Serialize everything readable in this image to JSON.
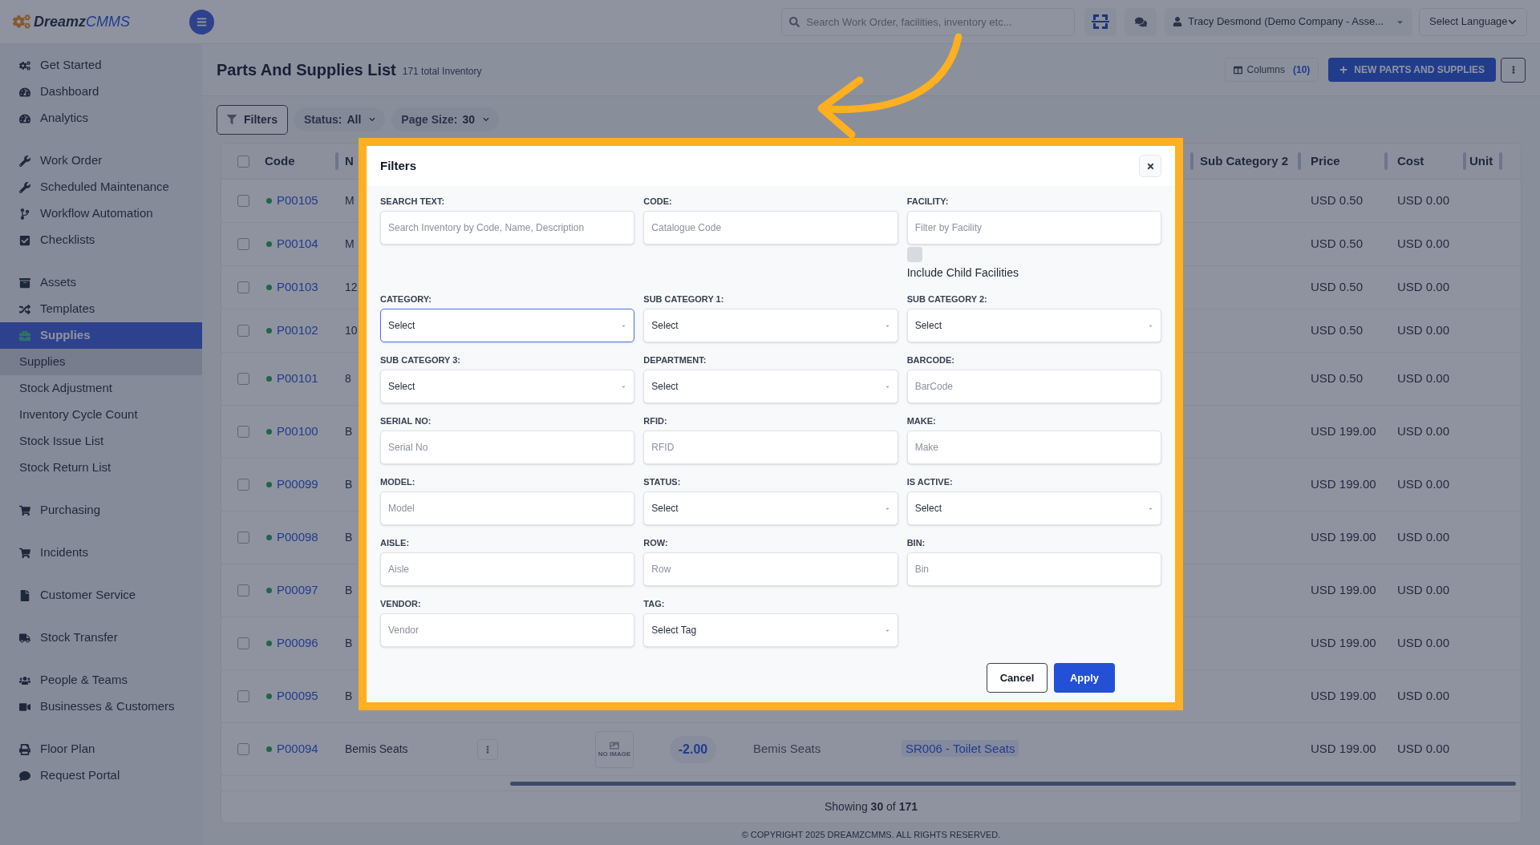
{
  "topbar": {
    "logo": {
      "word": "Dreamz",
      "accent": "CMMS"
    },
    "search": {
      "placeholder": "Search Work Order, facilities, inventory etc..."
    },
    "user": "Tracy Desmond (Demo Company - Asse...",
    "language": "Select Language"
  },
  "sidebar": {
    "groups": [
      {
        "items": [
          {
            "label": "Get Started",
            "selected": false
          },
          {
            "label": "Dashboard",
            "selected": false
          },
          {
            "label": "Analytics",
            "selected": false
          }
        ]
      },
      {
        "items": [
          {
            "label": "Work Order",
            "selected": false
          },
          {
            "label": "Scheduled Maintenance",
            "selected": false
          },
          {
            "label": "Workflow Automation",
            "selected": false
          },
          {
            "label": "Checklists",
            "selected": false
          }
        ]
      },
      {
        "items": [
          {
            "label": "Assets",
            "selected": false
          },
          {
            "label": "Templates",
            "selected": false
          },
          {
            "label": "Supplies",
            "selected": true,
            "children": [
              {
                "label": "Supplies",
                "selected": true
              },
              {
                "label": "Stock Adjustment",
                "selected": false
              },
              {
                "label": "Inventory Cycle Count",
                "selected": false
              },
              {
                "label": "Stock Issue List",
                "selected": false
              },
              {
                "label": "Stock Return List",
                "selected": false
              }
            ]
          }
        ]
      },
      {
        "items": [
          {
            "label": "Purchasing",
            "selected": false
          }
        ]
      },
      {
        "items": [
          {
            "label": "Incidents",
            "selected": false
          }
        ]
      },
      {
        "items": [
          {
            "label": "Customer Service",
            "selected": false
          }
        ]
      },
      {
        "items": [
          {
            "label": "Stock Transfer",
            "selected": false
          }
        ]
      },
      {
        "items": [
          {
            "label": "People & Teams",
            "selected": false
          },
          {
            "label": "Businesses & Customers",
            "selected": false
          }
        ]
      },
      {
        "items": [
          {
            "label": "Floor Plan",
            "selected": false
          },
          {
            "label": "Request Portal",
            "selected": false
          }
        ]
      }
    ]
  },
  "page": {
    "title": "Parts And Supplies List",
    "subtitle": "171 total Inventory",
    "columns_button": {
      "label": "Columns",
      "count": "(10)"
    },
    "new_button": "NEW PARTS AND SUPPLIES",
    "filters": [
      {
        "kind": "button",
        "label": "Filters"
      },
      {
        "kind": "chip",
        "label": "Status:",
        "value": "All"
      },
      {
        "kind": "chip",
        "label": "Page Size:",
        "value": "30"
      }
    ]
  },
  "table": {
    "select_all": {
      "checked": false
    },
    "columns": {
      "code": "Code",
      "name": "N",
      "sub_category_2": "Sub Category 2",
      "price": "Price",
      "cost": "Cost",
      "unit": "Unit"
    },
    "rows": [
      {
        "checked": false,
        "code": "P00105",
        "name": "M",
        "price": "USD 0.50",
        "cost": "USD 0.00"
      },
      {
        "checked": false,
        "code": "P00104",
        "name": "M",
        "price": "USD 0.50",
        "cost": "USD 0.00"
      },
      {
        "checked": false,
        "code": "P00103",
        "name": "12",
        "price": "USD 0.50",
        "cost": "USD 0.00"
      },
      {
        "checked": false,
        "code": "P00102",
        "name": "10",
        "price": "USD 0.50",
        "cost": "USD 0.00"
      },
      {
        "checked": false,
        "code": "P00101",
        "name": "8",
        "price": "USD 0.50",
        "cost": "USD 0.00"
      },
      {
        "checked": false,
        "code": "P00100",
        "name": "B",
        "price": "USD 199.00",
        "cost": "USD 0.00"
      },
      {
        "checked": false,
        "code": "P00099",
        "name": "B",
        "price": "USD 199.00",
        "cost": "USD 0.00"
      },
      {
        "checked": false,
        "code": "P00098",
        "name": "B",
        "price": "USD 199.00",
        "cost": "USD 0.00"
      },
      {
        "checked": false,
        "code": "P00097",
        "name": "B",
        "price": "USD 199.00",
        "cost": "USD 0.00"
      },
      {
        "checked": false,
        "code": "P00096",
        "name": "B",
        "price": "USD 199.00",
        "cost": "USD 0.00"
      },
      {
        "checked": false,
        "code": "P00095",
        "name": "B",
        "price": "USD 199.00",
        "cost": "USD 0.00"
      },
      {
        "checked": false,
        "code": "P00094",
        "name": "Bemis Seats",
        "image": "NO IMAGE",
        "quantity": "-2.00",
        "description": "Bemis Seats",
        "category": "SR006 - Toilet Seats",
        "price": "USD 199.00",
        "cost": "USD 0.00"
      }
    ],
    "footer": "Showing **30** of **171**"
  },
  "modal": {
    "title": "Filters",
    "fields": [
      {
        "label": "SEARCH TEXT:",
        "kind": "text",
        "placeholder": "Search Inventory by Code, Name, Description",
        "focused": false
      },
      {
        "label": "CODE:",
        "kind": "text",
        "placeholder": "Catalogue Code",
        "focused": false
      },
      {
        "label": "FACILITY:",
        "kind": "text",
        "placeholder": "Filter by Facility",
        "focused": false,
        "option": {
          "label": "Include Child Facilities",
          "checked": false
        }
      },
      {
        "label": "CATEGORY:",
        "kind": "select",
        "value": "Select",
        "focused": true
      },
      {
        "label": "SUB CATEGORY 1:",
        "kind": "select",
        "value": "Select",
        "focused": false
      },
      {
        "label": "SUB CATEGORY 2:",
        "kind": "select",
        "value": "Select",
        "focused": false
      },
      {
        "label": "SUB CATEGORY 3:",
        "kind": "select",
        "value": "Select",
        "focused": false
      },
      {
        "label": "DEPARTMENT:",
        "kind": "select",
        "value": "Select",
        "focused": false
      },
      {
        "label": "BARCODE:",
        "kind": "text",
        "placeholder": "BarCode",
        "focused": false
      },
      {
        "label": "SERIAL NO:",
        "kind": "text",
        "placeholder": "Serial No",
        "focused": false
      },
      {
        "label": "RFID:",
        "kind": "text",
        "placeholder": "RFID",
        "focused": false
      },
      {
        "label": "MAKE:",
        "kind": "text",
        "placeholder": "Make",
        "focused": false
      },
      {
        "label": "MODEL:",
        "kind": "text",
        "placeholder": "Model",
        "focused": false
      },
      {
        "label": "STATUS:",
        "kind": "select",
        "value": "Select",
        "focused": false
      },
      {
        "label": "IS ACTIVE:",
        "kind": "select",
        "value": "Select",
        "focused": false
      },
      {
        "label": "AISLE:",
        "kind": "text",
        "placeholder": "Aisle",
        "focused": false
      },
      {
        "label": "ROW:",
        "kind": "text",
        "placeholder": "Row",
        "focused": false
      },
      {
        "label": "BIN:",
        "kind": "text",
        "placeholder": "Bin",
        "focused": false
      },
      {
        "label": "VENDOR:",
        "kind": "text",
        "placeholder": "Vendor",
        "focused": false
      },
      {
        "label": "TAG:",
        "kind": "select",
        "value": "Select Tag",
        "focused": false
      }
    ],
    "buttons": [
      {
        "kind": "secondary",
        "label": "Cancel"
      },
      {
        "kind": "primary",
        "label": "Apply"
      }
    ]
  },
  "footer": "© COPYRIGHT 2025 DREAMZCMMS. ALL RIGHTS RESERVED."
}
